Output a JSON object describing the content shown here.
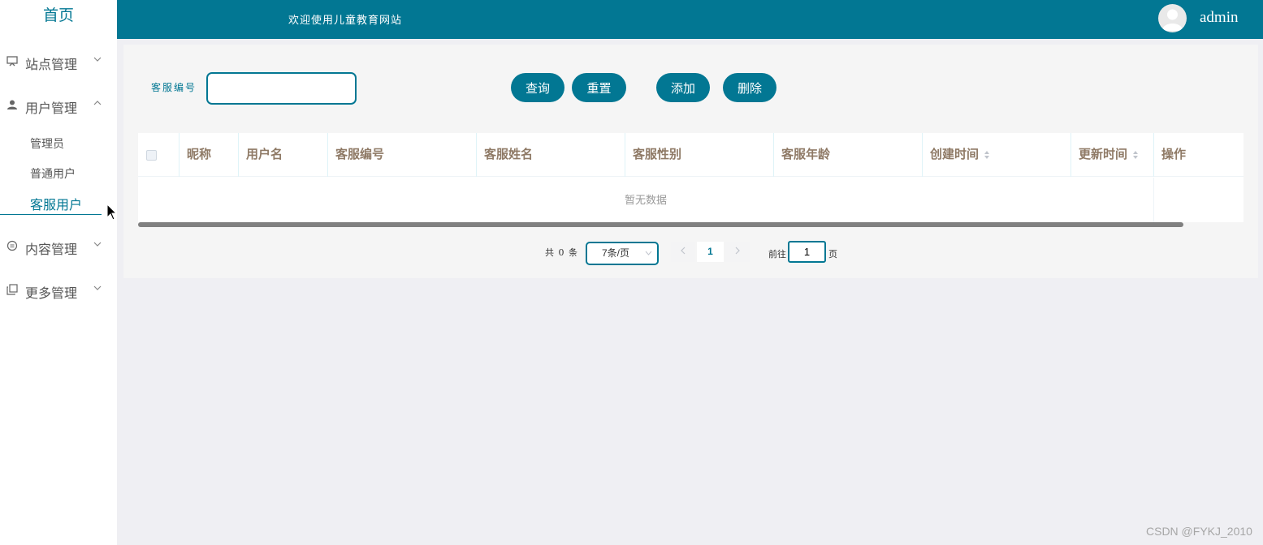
{
  "sidebar": {
    "home": "首页",
    "menus": [
      {
        "label": "站点管理",
        "icon": "monitor-icon",
        "expanded": false
      },
      {
        "label": "用户管理",
        "icon": "user-icon",
        "expanded": true
      },
      {
        "label": "内容管理",
        "icon": "message-icon",
        "expanded": false
      },
      {
        "label": "更多管理",
        "icon": "copy-icon",
        "expanded": false
      }
    ],
    "user_sub": [
      "管理员",
      "普通用户",
      "客服用户"
    ],
    "active_sub": "客服用户"
  },
  "header": {
    "welcome": "欢迎使用儿童教育网站",
    "username": "admin"
  },
  "search": {
    "label": "客服编号",
    "value": "",
    "placeholder": ""
  },
  "buttons": {
    "query": "查询",
    "reset": "重置",
    "add": "添加",
    "delete": "删除"
  },
  "table": {
    "columns": [
      "昵称",
      "用户名",
      "客服编号",
      "客服姓名",
      "客服性别",
      "客服年龄",
      "创建时间",
      "更新时间",
      "操作"
    ],
    "empty_text": "暂无数据"
  },
  "pagination": {
    "total": "共 0 条",
    "page_size": "7条/页",
    "current_page": "1",
    "goto_label": "前往",
    "goto_value": "1",
    "goto_unit": "页"
  },
  "watermark": "CSDN @FYKJ_2010",
  "colors": {
    "primary": "#027793",
    "header_text": "#8f7a66"
  }
}
